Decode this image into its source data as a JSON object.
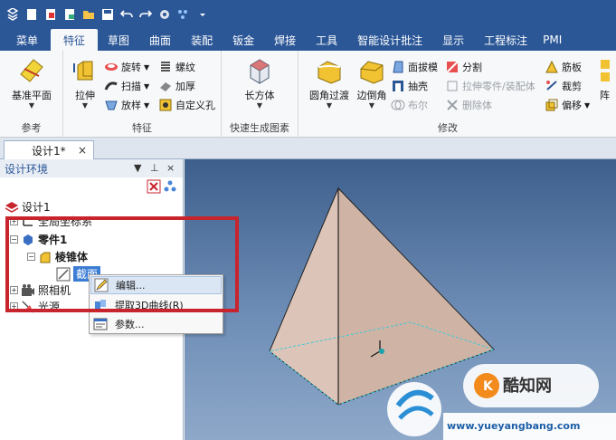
{
  "quick_access": {
    "icons": [
      "app-menu-icon",
      "new-icon",
      "new-from-template-icon",
      "open-icon",
      "folder-icon",
      "save-icon",
      "undo-icon",
      "redo-icon",
      "gear-icon",
      "display-icon",
      "more-icon"
    ]
  },
  "tabs": [
    {
      "label": "菜单",
      "active": false
    },
    {
      "label": "特征",
      "active": true
    },
    {
      "label": "草图",
      "active": false
    },
    {
      "label": "曲面",
      "active": false
    },
    {
      "label": "装配",
      "active": false
    },
    {
      "label": "钣金",
      "active": false
    },
    {
      "label": "焊接",
      "active": false
    },
    {
      "label": "工具",
      "active": false
    },
    {
      "label": "智能设计批注",
      "active": false
    },
    {
      "label": "显示",
      "active": false
    },
    {
      "label": "工程标注",
      "active": false
    },
    {
      "label": "PMI",
      "active": false
    }
  ],
  "ribbon": {
    "reference": {
      "group_label": "参考",
      "datum_plane": "基准平面"
    },
    "features": {
      "group_label": "特征",
      "extrude": "拉伸",
      "revolve": "旋转",
      "sweep": "扫描",
      "loft": "放样",
      "thread": "螺纹",
      "thicken": "加厚",
      "custom_hole": "自定义孔"
    },
    "quick_shapes": {
      "group_label": "快速生成图素",
      "box": "长方体"
    },
    "modify": {
      "group_label": "修改",
      "fillet": "圆角过渡",
      "chamfer": "边倒角",
      "draft": "面拔模",
      "shell": "抽壳",
      "boolean": "布尔",
      "split": "分割",
      "extrude_to_part": "拉伸零件/装配体",
      "delete_body": "删除体",
      "rib": "筋板",
      "trim": "裁剪",
      "offset": "偏移",
      "array": "阵"
    }
  },
  "document_tab": {
    "label": "设计1*",
    "close": "×"
  },
  "panel": {
    "title": "设计环境",
    "tree": {
      "root": "设计1",
      "global_cs": "全局坐标系",
      "part": "零件1",
      "body": "棱锥体",
      "section": "截面",
      "camera": "照相机",
      "light": "光源"
    }
  },
  "context_menu": {
    "items": [
      {
        "label": "编辑..."
      },
      {
        "label": "提取3D曲线(R)"
      },
      {
        "label": "参数..."
      }
    ]
  },
  "watermark": {
    "site_text": "酷知网",
    "domain_text": "www.yueyangbang.com"
  },
  "colors": {
    "title_bar": "#2b5797",
    "highlight_box": "#c8242d",
    "selection": "#3b7cd4"
  }
}
